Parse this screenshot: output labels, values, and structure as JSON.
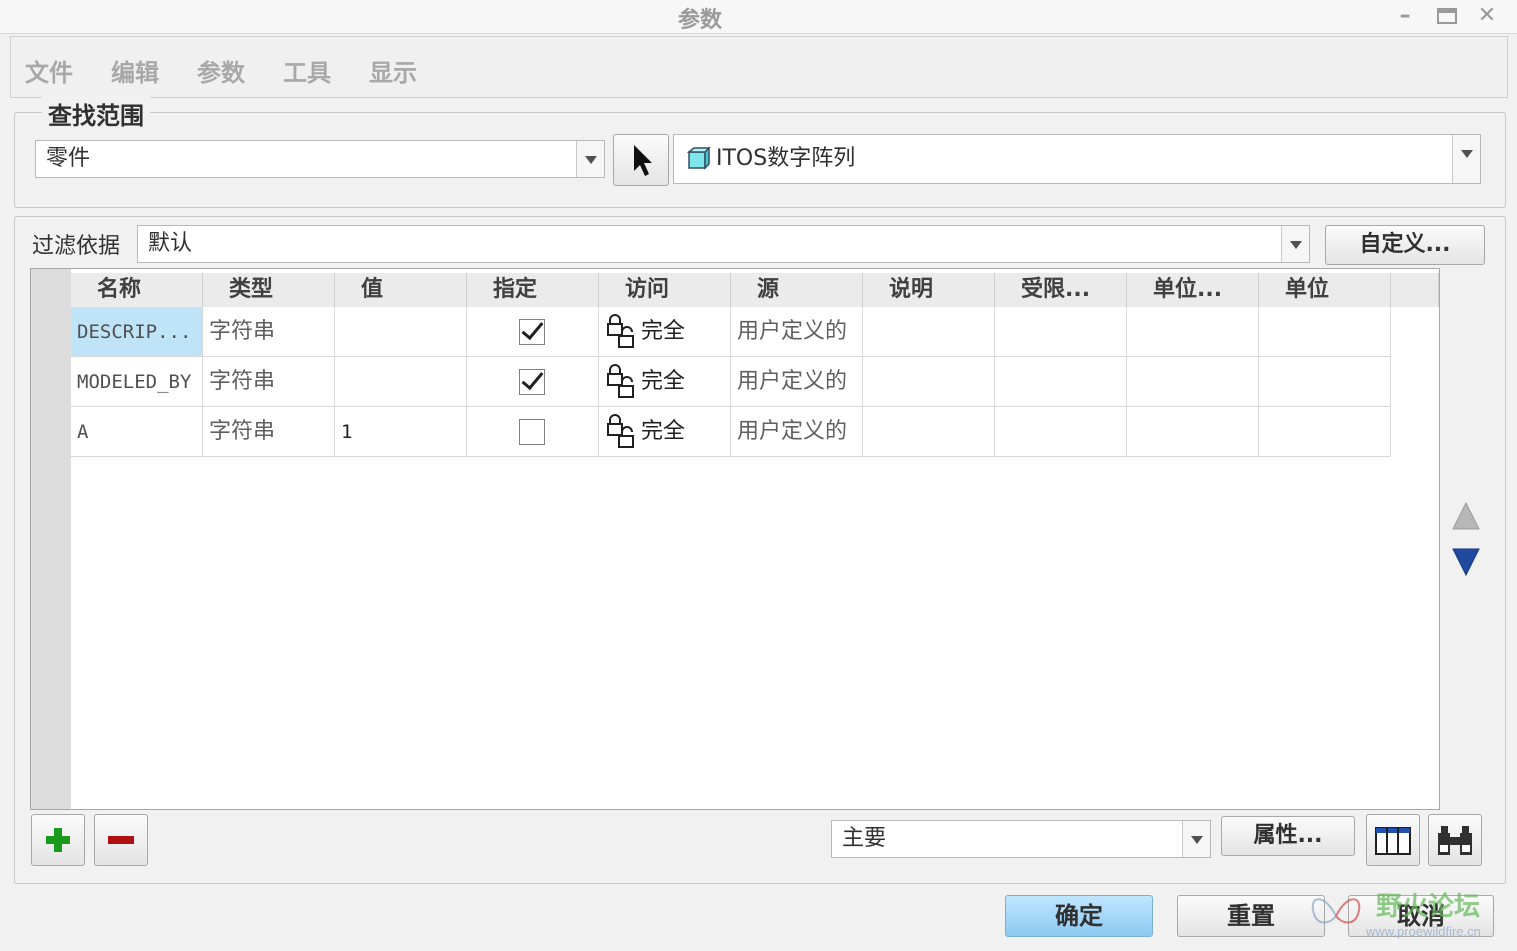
{
  "window": {
    "title": "参数"
  },
  "menu": [
    "文件",
    "编辑",
    "参数",
    "工具",
    "显示"
  ],
  "search_scope": {
    "legend": "查找范围",
    "type_value": "零件",
    "model_value": "ITOS数字阵列"
  },
  "filter": {
    "label": "过滤依据",
    "value": "默认",
    "custom_button": "自定义..."
  },
  "table": {
    "columns": [
      "名称",
      "类型",
      "值",
      "指定",
      "访问",
      "源",
      "说明",
      "受限...",
      "单位...",
      "单位"
    ],
    "rows": [
      {
        "name": "DESCRIP...",
        "type": "字符串",
        "value": "",
        "designated": true,
        "access": "完全",
        "source": "用户定义的",
        "selected": true
      },
      {
        "name": "MODELED_BY",
        "type": "字符串",
        "value": "",
        "designated": true,
        "access": "完全",
        "source": "用户定义的",
        "selected": false
      },
      {
        "name": "A",
        "type": "字符串",
        "value": "1",
        "designated": false,
        "access": "完全",
        "source": "用户定义的",
        "selected": false
      }
    ]
  },
  "bottom_bar": {
    "view_value": "主要",
    "properties_button": "属性..."
  },
  "footer": {
    "ok": "确定",
    "reset": "重置",
    "cancel": "取消"
  },
  "watermark": {
    "text": "野火论坛",
    "url": "www.proewildfire.cn"
  },
  "colors": {
    "selection": "#bfe4f7",
    "ok_button": "#8ccaf2",
    "add_icon": "#1a9a1a",
    "remove_icon": "#b01010",
    "arrow_down": "#1f4aa0"
  }
}
